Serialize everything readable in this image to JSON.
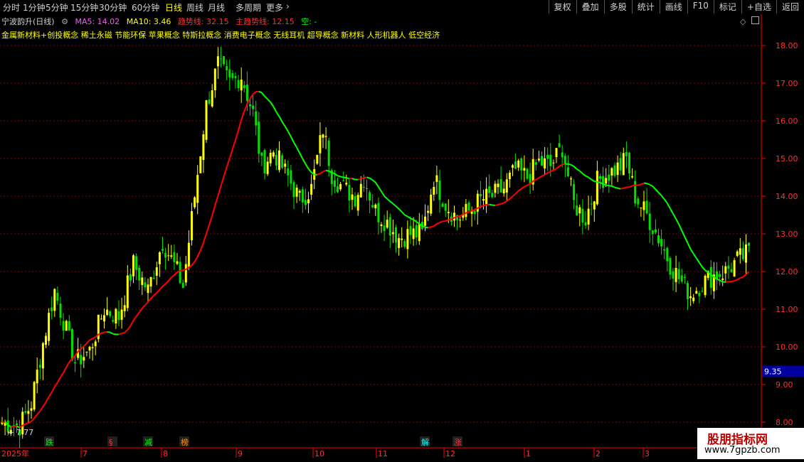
{
  "toolbar": {
    "timeframes": [
      "分时",
      "1分钟",
      "5分钟",
      "15分钟",
      "30分钟",
      "60分钟",
      "日线",
      "周线",
      "月线",
      "多周期",
      "更多"
    ],
    "active": "日线",
    "right_buttons": [
      "复权",
      "叠加",
      "多股",
      "统计",
      "画线",
      "F10",
      "标记",
      "+自选",
      "返回"
    ]
  },
  "header": {
    "stock": "宁波韵升(日线)",
    "ma5": "MA5: 14.02",
    "ma10": "MA10: 3.46",
    "trend": "趋势线: 32.15",
    "main_trend": "主趋势线: 12.15",
    "empty": "空: -",
    "concepts": "金属新材料+创投概念 稀土永磁 节能环保 苹果概念 特斯拉概念 消费电子概念 无线耳机 超导概念 新材料 人形机器人 低空经济"
  },
  "colors": {
    "up": "#ffff00",
    "down": "#00e000",
    "ma_red": "#ff0000",
    "ma_green": "#00ff00",
    "grid": "#8b0000",
    "axis": "#ff0000",
    "price_tag_bg": "#0000a0"
  },
  "chart_data": {
    "type": "candlestick",
    "title": "宁波韵升(日线)",
    "ylim": [
      7.7,
      18.8
    ],
    "y_ticks": [
      "8.00",
      "9.00",
      "10.00",
      "11.00",
      "12.00",
      "13.00",
      "14.00",
      "15.00",
      "16.00",
      "17.00",
      "18.00"
    ],
    "x_labels": [
      "2025年",
      "7",
      "8",
      "9",
      "10",
      "11",
      "12",
      "1",
      "2",
      "3"
    ],
    "current_price_tag": "9.35",
    "low_marker": "7.77",
    "signal_labels": [
      "跌",
      "§",
      "减",
      "榜",
      "解",
      "涨"
    ],
    "anchors": [
      [
        0,
        8.0
      ],
      [
        6,
        7.9
      ],
      [
        10,
        8.5
      ],
      [
        14,
        10.1
      ],
      [
        18,
        11.5
      ],
      [
        21,
        10.7
      ],
      [
        25,
        9.6
      ],
      [
        30,
        9.9
      ],
      [
        35,
        11.0
      ],
      [
        40,
        10.8
      ],
      [
        45,
        12.2
      ],
      [
        50,
        11.5
      ],
      [
        55,
        12.8
      ],
      [
        60,
        12.0
      ],
      [
        62,
        11.6
      ],
      [
        66,
        14.0
      ],
      [
        70,
        16.4
      ],
      [
        74,
        17.5
      ],
      [
        78,
        17.0
      ],
      [
        82,
        17.2
      ],
      [
        86,
        16.2
      ],
      [
        89,
        14.8
      ],
      [
        93,
        15.2
      ],
      [
        98,
        14.5
      ],
      [
        102,
        13.9
      ],
      [
        106,
        14.2
      ],
      [
        110,
        15.8
      ],
      [
        113,
        14.6
      ],
      [
        117,
        14.2
      ],
      [
        121,
        14.0
      ],
      [
        124,
        14.5
      ],
      [
        128,
        13.6
      ],
      [
        132,
        13.3
      ],
      [
        136,
        12.9
      ],
      [
        140,
        13.0
      ],
      [
        144,
        13.0
      ],
      [
        148,
        14.5
      ],
      [
        152,
        13.8
      ],
      [
        156,
        13.4
      ],
      [
        160,
        13.6
      ],
      [
        164,
        13.9
      ],
      [
        168,
        14.0
      ],
      [
        172,
        14.2
      ],
      [
        176,
        14.7
      ],
      [
        180,
        14.5
      ],
      [
        184,
        14.9
      ],
      [
        188,
        14.8
      ],
      [
        192,
        15.3
      ],
      [
        196,
        13.8
      ],
      [
        200,
        13.4
      ],
      [
        204,
        14.4
      ],
      [
        208,
        14.6
      ],
      [
        212,
        14.8
      ],
      [
        214,
        15.0
      ],
      [
        217,
        14.0
      ],
      [
        221,
        13.5
      ],
      [
        225,
        12.9
      ],
      [
        229,
        12.2
      ],
      [
        233,
        11.7
      ],
      [
        236,
        11.4
      ],
      [
        240,
        11.7
      ],
      [
        244,
        11.9
      ],
      [
        248,
        12.0
      ],
      [
        252,
        12.3
      ],
      [
        256,
        12.5
      ]
    ],
    "count": 257
  }
}
